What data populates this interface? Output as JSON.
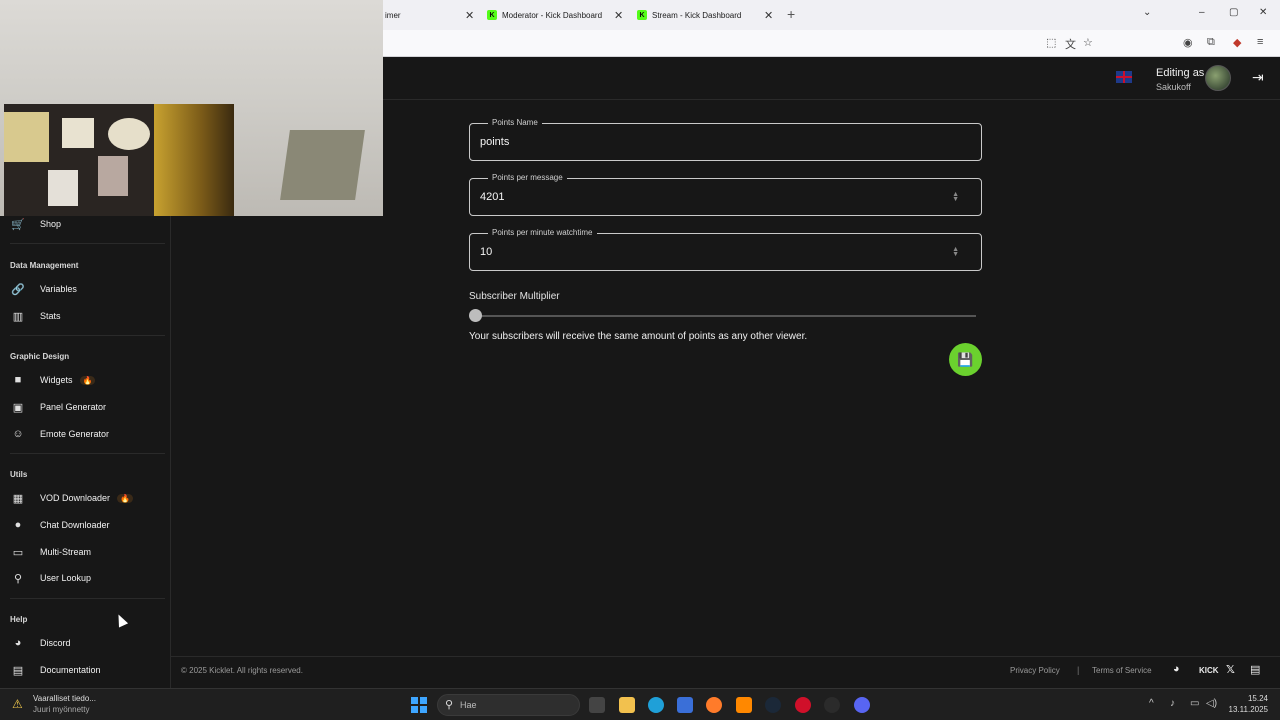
{
  "browser": {
    "tabs": [
      {
        "label": "imer",
        "favicon": false
      },
      {
        "label": "Moderator - Kick Dashboard",
        "favicon": true
      },
      {
        "label": "Stream - Kick Dashboard",
        "favicon": true
      }
    ],
    "new_tab_icon": "plus-icon"
  },
  "header": {
    "language_flag": "uk-flag-icon",
    "editing_label": "Editing as",
    "username": "Sakukoff"
  },
  "sidebar": {
    "top_items": [
      {
        "label": "Shop",
        "icon": "cart-icon"
      }
    ],
    "sections": [
      {
        "title": "Data Management",
        "items": [
          {
            "label": "Variables",
            "icon": "link-icon"
          },
          {
            "label": "Stats",
            "icon": "bar-chart-icon"
          }
        ]
      },
      {
        "title": "Graphic Design",
        "items": [
          {
            "label": "Widgets",
            "icon": "video-icon",
            "badge": "🔥"
          },
          {
            "label": "Panel Generator",
            "icon": "image-icon"
          },
          {
            "label": "Emote Generator",
            "icon": "emoji-icon"
          }
        ]
      },
      {
        "title": "Utils",
        "items": [
          {
            "label": "VOD Downloader",
            "icon": "film-icon",
            "badge": "🔥"
          },
          {
            "label": "Chat Downloader",
            "icon": "chat-icon"
          },
          {
            "label": "Multi-Stream",
            "icon": "monitor-icon"
          },
          {
            "label": "User Lookup",
            "icon": "search-icon"
          }
        ]
      },
      {
        "title": "Help",
        "items": [
          {
            "label": "Discord",
            "icon": "discord-icon"
          },
          {
            "label": "Documentation",
            "icon": "docs-icon"
          }
        ]
      }
    ]
  },
  "form": {
    "points_name": {
      "label": "Points Name",
      "value": "points"
    },
    "points_per_message": {
      "label": "Points per message",
      "value": "4201"
    },
    "points_per_minute": {
      "label": "Points per minute watchtime",
      "value": "10"
    },
    "subscriber_multiplier": {
      "label": "Subscriber Multiplier",
      "value_fraction": 0.0,
      "helper": "Your subscribers will receive the same amount of points as any other viewer."
    },
    "save_icon": "save-icon"
  },
  "footer": {
    "copyright": "© 2025 Kicklet. All rights reserved.",
    "privacy": "Privacy Policy",
    "separator": "|",
    "terms": "Terms of Service",
    "kick_label": "KICK",
    "x_label": "𝕏"
  },
  "taskbar": {
    "warning_title": "Vaaralliset tiedo...",
    "warning_subtitle": "Juuri myönnetty",
    "search_placeholder": "Hae",
    "time": "15.24",
    "date": "13.11.2025"
  },
  "colors": {
    "background": "#171717",
    "accent_green": "#6bd12e",
    "kick_green": "#53fc18"
  }
}
